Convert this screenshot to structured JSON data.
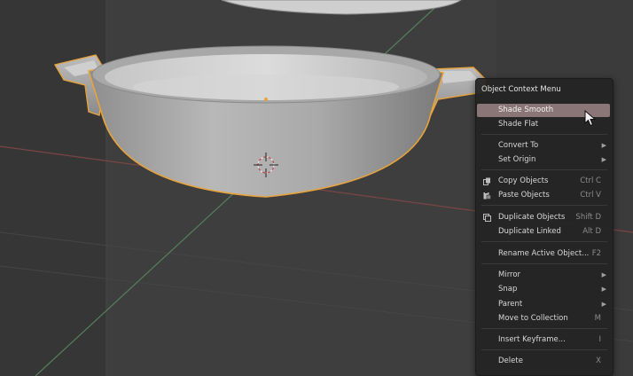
{
  "menu": {
    "title": "Object Context Menu",
    "items": [
      {
        "label": "Shade Smooth",
        "shortcut": "",
        "submenu": false,
        "highlighted": true
      },
      {
        "label": "Shade Flat",
        "shortcut": "",
        "submenu": false
      },
      {
        "label": "Convert To",
        "shortcut": "",
        "submenu": true
      },
      {
        "label": "Set Origin",
        "shortcut": "",
        "submenu": true
      },
      {
        "label": "Copy Objects",
        "shortcut": "Ctrl C",
        "submenu": false,
        "icon": "copy-icon"
      },
      {
        "label": "Paste Objects",
        "shortcut": "Ctrl V",
        "submenu": false,
        "icon": "paste-icon"
      },
      {
        "label": "Duplicate Objects",
        "shortcut": "Shift D",
        "submenu": false,
        "icon": "duplicate-icon"
      },
      {
        "label": "Duplicate Linked",
        "shortcut": "Alt D",
        "submenu": false
      },
      {
        "label": "Rename Active Object...",
        "shortcut": "F2",
        "submenu": false
      },
      {
        "label": "Mirror",
        "shortcut": "",
        "submenu": true
      },
      {
        "label": "Snap",
        "shortcut": "",
        "submenu": true
      },
      {
        "label": "Parent",
        "shortcut": "",
        "submenu": true
      },
      {
        "label": "Move to Collection",
        "shortcut": "M",
        "submenu": false
      },
      {
        "label": "Insert Keyframe...",
        "shortcut": "I",
        "submenu": false
      },
      {
        "label": "Delete",
        "shortcut": "X",
        "submenu": false
      }
    ]
  },
  "viewport": {
    "selected_object": "bowl-with-handles",
    "outline_color": "#e8a33a",
    "background_color": "#3c3c3c",
    "x_axis_color": "#8a4a4a",
    "y_axis_color": "#5d8a54"
  }
}
